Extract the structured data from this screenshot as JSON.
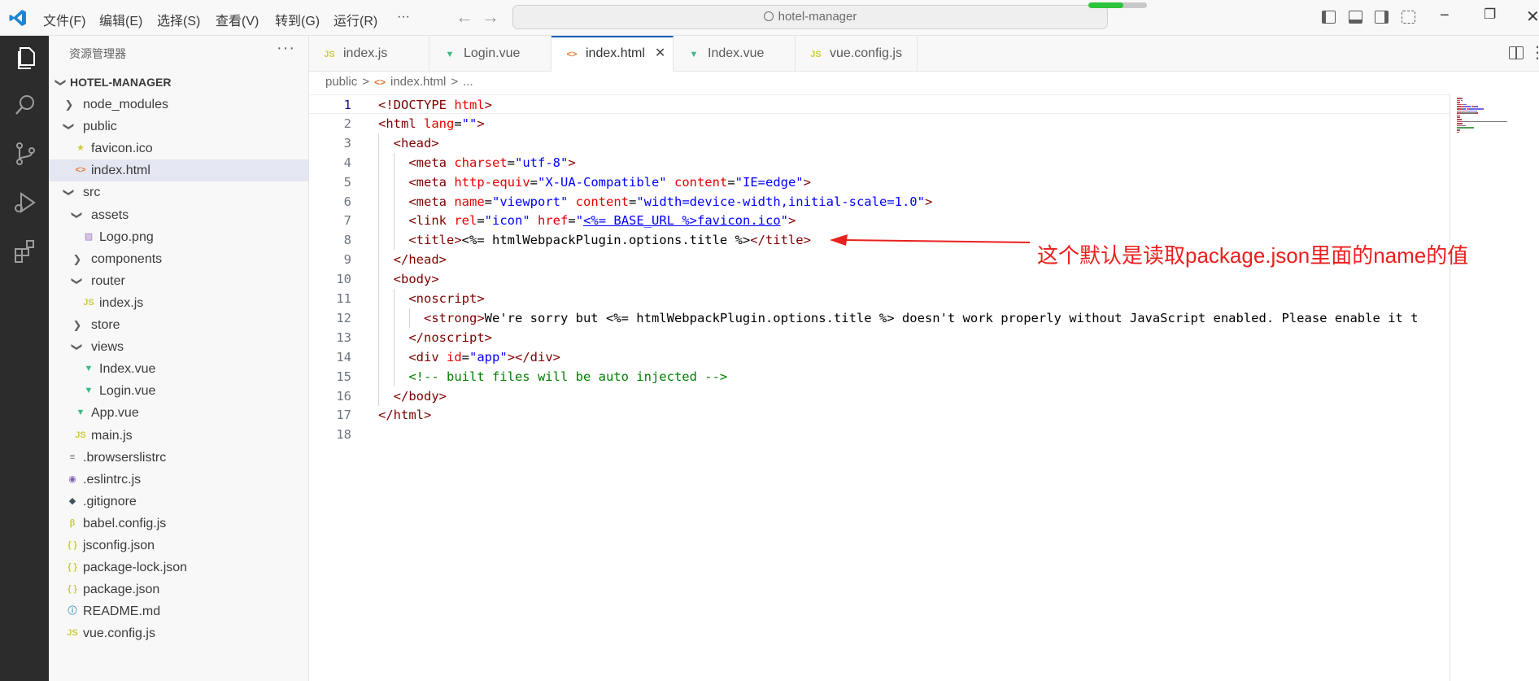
{
  "titlebar": {
    "menu": [
      "文件(F)",
      "编辑(E)",
      "选择(S)",
      "查看(V)",
      "转到(G)",
      "运行(R)",
      "···"
    ],
    "search_text": "hotel-manager",
    "progress": 0.6,
    "accent_color": "#005fb8",
    "progress_color": "#2ec43a"
  },
  "activity_bar": [
    "explorer-icon",
    "search-icon",
    "source-control-icon",
    "run-debug-icon",
    "extensions-icon"
  ],
  "sidebar": {
    "title": "资源管理器",
    "more": "···",
    "root": "HOTEL-MANAGER",
    "items": [
      {
        "label": "node_modules",
        "kind": "folder",
        "open": false
      },
      {
        "label": "public",
        "kind": "folder",
        "open": true
      },
      {
        "label": "favicon.ico",
        "kind": "favicon"
      },
      {
        "label": "index.html",
        "kind": "html",
        "selected": true
      },
      {
        "label": "src",
        "kind": "folder",
        "open": true
      },
      {
        "label": "assets",
        "kind": "folder",
        "open": true
      },
      {
        "label": "Logo.png",
        "kind": "image"
      },
      {
        "label": "components",
        "kind": "folder",
        "open": false
      },
      {
        "label": "router",
        "kind": "folder",
        "open": true
      },
      {
        "label": "index.js",
        "kind": "js"
      },
      {
        "label": "store",
        "kind": "folder",
        "open": false
      },
      {
        "label": "views",
        "kind": "folder",
        "open": true
      },
      {
        "label": "Index.vue",
        "kind": "vue"
      },
      {
        "label": "Login.vue",
        "kind": "vue"
      },
      {
        "label": "App.vue",
        "kind": "vue"
      },
      {
        "label": "main.js",
        "kind": "js"
      },
      {
        "label": ".browserslistrc",
        "kind": "text"
      },
      {
        "label": ".eslintrc.js",
        "kind": "eslint"
      },
      {
        "label": ".gitignore",
        "kind": "git"
      },
      {
        "label": "babel.config.js",
        "kind": "babel"
      },
      {
        "label": "jsconfig.json",
        "kind": "json"
      },
      {
        "label": "package-lock.json",
        "kind": "json"
      },
      {
        "label": "package.json",
        "kind": "json"
      },
      {
        "label": "README.md",
        "kind": "info"
      },
      {
        "label": "vue.config.js",
        "kind": "js"
      }
    ]
  },
  "tabs": [
    {
      "label": "index.js",
      "kind": "js",
      "active": false
    },
    {
      "label": "Login.vue",
      "kind": "vue",
      "active": false
    },
    {
      "label": "index.html",
      "kind": "html",
      "active": true
    },
    {
      "label": "Index.vue",
      "kind": "vue",
      "active": false
    },
    {
      "label": "vue.config.js",
      "kind": "js",
      "active": false
    }
  ],
  "breadcrumb": [
    "public",
    ">",
    "<>",
    "index.html",
    ">",
    "..."
  ],
  "code_lines": [
    [
      {
        "t": "<!DOCTYPE ",
        "c": "tg"
      },
      {
        "t": "html",
        "c": "at"
      },
      {
        "t": ">",
        "c": "tg"
      }
    ],
    [
      {
        "t": "<html ",
        "c": "tg"
      },
      {
        "t": "lang",
        "c": "at"
      },
      {
        "t": "=",
        "c": "tx"
      },
      {
        "t": "\"\"",
        "c": "st"
      },
      {
        "t": ">",
        "c": "tg"
      }
    ],
    [
      {
        "t": "  <head>",
        "c": "tg"
      }
    ],
    [
      {
        "t": "    <meta ",
        "c": "tg"
      },
      {
        "t": "charset",
        "c": "at"
      },
      {
        "t": "=",
        "c": "tx"
      },
      {
        "t": "\"utf-8\"",
        "c": "st"
      },
      {
        "t": ">",
        "c": "tg"
      }
    ],
    [
      {
        "t": "    <meta ",
        "c": "tg"
      },
      {
        "t": "http-equiv",
        "c": "at"
      },
      {
        "t": "=",
        "c": "tx"
      },
      {
        "t": "\"X-UA-Compatible\"",
        "c": "st"
      },
      {
        "t": " ",
        "c": "tx"
      },
      {
        "t": "content",
        "c": "at"
      },
      {
        "t": "=",
        "c": "tx"
      },
      {
        "t": "\"IE=edge\"",
        "c": "st"
      },
      {
        "t": ">",
        "c": "tg"
      }
    ],
    [
      {
        "t": "    <meta ",
        "c": "tg"
      },
      {
        "t": "name",
        "c": "at"
      },
      {
        "t": "=",
        "c": "tx"
      },
      {
        "t": "\"viewport\"",
        "c": "st"
      },
      {
        "t": " ",
        "c": "tx"
      },
      {
        "t": "content",
        "c": "at"
      },
      {
        "t": "=",
        "c": "tx"
      },
      {
        "t": "\"width=device-width,initial-scale=1.0\"",
        "c": "st"
      },
      {
        "t": ">",
        "c": "tg"
      }
    ],
    [
      {
        "t": "    <link ",
        "c": "tg"
      },
      {
        "t": "rel",
        "c": "at"
      },
      {
        "t": "=",
        "c": "tx"
      },
      {
        "t": "\"icon\"",
        "c": "st"
      },
      {
        "t": " ",
        "c": "tx"
      },
      {
        "t": "href",
        "c": "at"
      },
      {
        "t": "=",
        "c": "tx"
      },
      {
        "t": "\"",
        "c": "st"
      },
      {
        "t": "<%= BASE_URL %>favicon.ico",
        "c": "st link"
      },
      {
        "t": "\"",
        "c": "st"
      },
      {
        "t": ">",
        "c": "tg"
      }
    ],
    [
      {
        "t": "    <title>",
        "c": "tg"
      },
      {
        "t": "<%= htmlWebpackPlugin.options.title %>",
        "c": "tx"
      },
      {
        "t": "</title>",
        "c": "tg"
      }
    ],
    [
      {
        "t": "  </head>",
        "c": "tg"
      }
    ],
    [
      {
        "t": "  <body>",
        "c": "tg"
      }
    ],
    [
      {
        "t": "    <noscript>",
        "c": "tg"
      }
    ],
    [
      {
        "t": "      <strong>",
        "c": "tg"
      },
      {
        "t": "We're sorry but <%= htmlWebpackPlugin.options.title %> doesn't work properly without JavaScript enabled. Please enable it t",
        "c": "tx"
      }
    ],
    [
      {
        "t": "    </noscript>",
        "c": "tg"
      }
    ],
    [
      {
        "t": "    <div ",
        "c": "tg"
      },
      {
        "t": "id",
        "c": "at"
      },
      {
        "t": "=",
        "c": "tx"
      },
      {
        "t": "\"app\"",
        "c": "st"
      },
      {
        "t": "></div>",
        "c": "tg"
      }
    ],
    [
      {
        "t": "    <!-- built files will be auto injected -->",
        "c": "cm"
      }
    ],
    [
      {
        "t": "  </body>",
        "c": "tg"
      }
    ],
    [
      {
        "t": "</html>",
        "c": "tg"
      }
    ],
    []
  ],
  "current_line": 1,
  "annotation": "这个默认是读取package.json里面的name的值",
  "annotation_color": "#e8201e"
}
